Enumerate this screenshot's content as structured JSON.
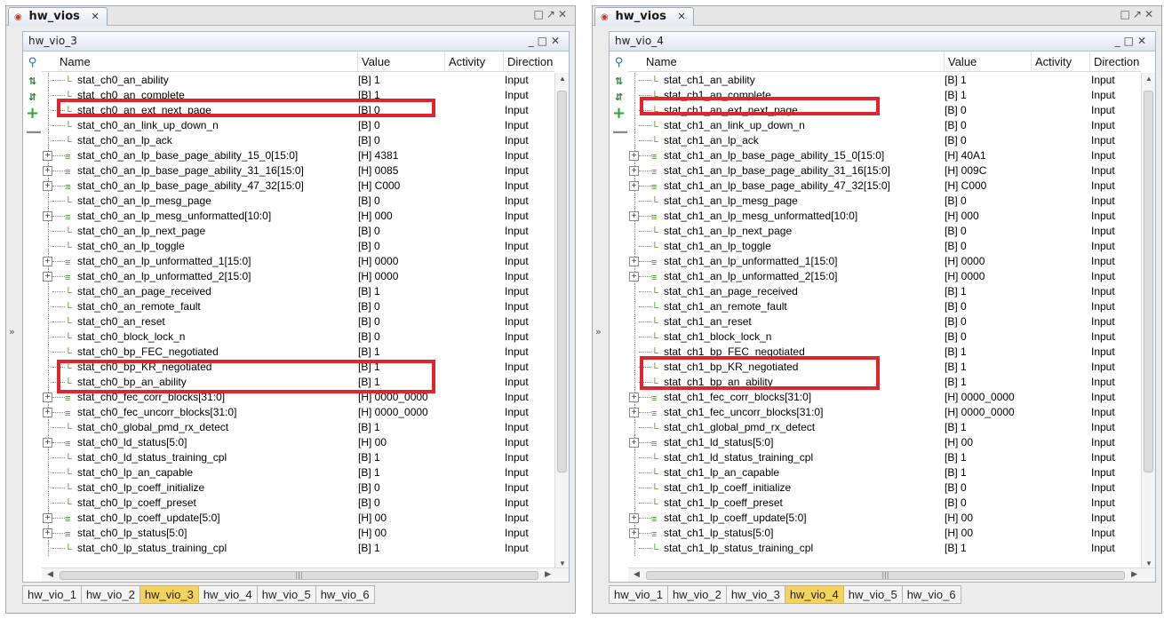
{
  "left": {
    "tab_title": "hw_vios",
    "panel_title": "hw_vio_3",
    "active_tab": "hw_vio_3",
    "rows": [
      {
        "name": "stat_ch0_an_ability",
        "value": "[B] 1",
        "dir": "Input",
        "bus": false
      },
      {
        "name": "stat_ch0_an_complete",
        "value": "[B] 1",
        "dir": "Input",
        "bus": false
      },
      {
        "name": "stat_ch0_an_ext_next_page",
        "value": "[B] 0",
        "dir": "Input",
        "bus": false
      },
      {
        "name": "stat_ch0_an_link_up_down_n",
        "value": "[B] 0",
        "dir": "Input",
        "bus": false
      },
      {
        "name": "stat_ch0_an_lp_ack",
        "value": "[B] 0",
        "dir": "Input",
        "bus": false
      },
      {
        "name": "stat_ch0_an_lp_base_page_ability_15_0[15:0]",
        "value": "[H] 4381",
        "dir": "Input",
        "bus": true
      },
      {
        "name": "stat_ch0_an_lp_base_page_ability_31_16[15:0]",
        "value": "[H] 0085",
        "dir": "Input",
        "bus": true
      },
      {
        "name": "stat_ch0_an_lp_base_page_ability_47_32[15:0]",
        "value": "[H] C000",
        "dir": "Input",
        "bus": true
      },
      {
        "name": "stat_ch0_an_lp_mesg_page",
        "value": "[B] 0",
        "dir": "Input",
        "bus": false
      },
      {
        "name": "stat_ch0_an_lp_mesg_unformatted[10:0]",
        "value": "[H] 000",
        "dir": "Input",
        "bus": true
      },
      {
        "name": "stat_ch0_an_lp_next_page",
        "value": "[B] 0",
        "dir": "Input",
        "bus": false
      },
      {
        "name": "stat_ch0_an_lp_toggle",
        "value": "[B] 0",
        "dir": "Input",
        "bus": false
      },
      {
        "name": "stat_ch0_an_lp_unformatted_1[15:0]",
        "value": "[H] 0000",
        "dir": "Input",
        "bus": true
      },
      {
        "name": "stat_ch0_an_lp_unformatted_2[15:0]",
        "value": "[H] 0000",
        "dir": "Input",
        "bus": true
      },
      {
        "name": "stat_ch0_an_page_received",
        "value": "[B] 1",
        "dir": "Input",
        "bus": false
      },
      {
        "name": "stat_ch0_an_remote_fault",
        "value": "[B] 0",
        "dir": "Input",
        "bus": false
      },
      {
        "name": "stat_ch0_an_reset",
        "value": "[B] 0",
        "dir": "Input",
        "bus": false
      },
      {
        "name": "stat_ch0_block_lock_n",
        "value": "[B] 0",
        "dir": "Input",
        "bus": false
      },
      {
        "name": "stat_ch0_bp_FEC_negotiated",
        "value": "[B] 1",
        "dir": "Input",
        "bus": false
      },
      {
        "name": "stat_ch0_bp_KR_negotiated",
        "value": "[B] 1",
        "dir": "Input",
        "bus": false
      },
      {
        "name": "stat_ch0_bp_an_ability",
        "value": "[B] 1",
        "dir": "Input",
        "bus": false
      },
      {
        "name": "stat_ch0_fec_corr_blocks[31:0]",
        "value": "[H] 0000_0000",
        "dir": "Input",
        "bus": true
      },
      {
        "name": "stat_ch0_fec_uncorr_blocks[31:0]",
        "value": "[H] 0000_0000",
        "dir": "Input",
        "bus": true
      },
      {
        "name": "stat_ch0_global_pmd_rx_detect",
        "value": "[B] 1",
        "dir": "Input",
        "bus": false
      },
      {
        "name": "stat_ch0_ld_status[5:0]",
        "value": "[H] 00",
        "dir": "Input",
        "bus": true
      },
      {
        "name": "stat_ch0_ld_status_training_cpl",
        "value": "[B] 1",
        "dir": "Input",
        "bus": false
      },
      {
        "name": "stat_ch0_lp_an_capable",
        "value": "[B] 1",
        "dir": "Input",
        "bus": false
      },
      {
        "name": "stat_ch0_lp_coeff_initialize",
        "value": "[B] 0",
        "dir": "Input",
        "bus": false
      },
      {
        "name": "stat_ch0_lp_coeff_preset",
        "value": "[B] 0",
        "dir": "Input",
        "bus": false
      },
      {
        "name": "stat_ch0_lp_coeff_update[5:0]",
        "value": "[H] 00",
        "dir": "Input",
        "bus": true
      },
      {
        "name": "stat_ch0_lp_status[5:0]",
        "value": "[H] 00",
        "dir": "Input",
        "bus": true
      },
      {
        "name": "stat_ch0_lp_status_training_cpl",
        "value": "[B] 1",
        "dir": "Input",
        "bus": false
      }
    ]
  },
  "right": {
    "tab_title": "hw_vios",
    "panel_title": "hw_vio_4",
    "active_tab": "hw_vio_4",
    "rows": [
      {
        "name": "stat_ch1_an_ability",
        "value": "[B] 1",
        "dir": "Input",
        "bus": false
      },
      {
        "name": "stat_ch1_an_complete",
        "value": "[B] 1",
        "dir": "Input",
        "bus": false
      },
      {
        "name": "stat_ch1_an_ext_next_page",
        "value": "[B] 0",
        "dir": "Input",
        "bus": false
      },
      {
        "name": "stat_ch1_an_link_up_down_n",
        "value": "[B] 0",
        "dir": "Input",
        "bus": false
      },
      {
        "name": "stat_ch1_an_lp_ack",
        "value": "[B] 0",
        "dir": "Input",
        "bus": false
      },
      {
        "name": "stat_ch1_an_lp_base_page_ability_15_0[15:0]",
        "value": "[H] 40A1",
        "dir": "Input",
        "bus": true
      },
      {
        "name": "stat_ch1_an_lp_base_page_ability_31_16[15:0]",
        "value": "[H] 009C",
        "dir": "Input",
        "bus": true
      },
      {
        "name": "stat_ch1_an_lp_base_page_ability_47_32[15:0]",
        "value": "[H] C000",
        "dir": "Input",
        "bus": true
      },
      {
        "name": "stat_ch1_an_lp_mesg_page",
        "value": "[B] 0",
        "dir": "Input",
        "bus": false
      },
      {
        "name": "stat_ch1_an_lp_mesg_unformatted[10:0]",
        "value": "[H] 000",
        "dir": "Input",
        "bus": true
      },
      {
        "name": "stat_ch1_an_lp_next_page",
        "value": "[B] 0",
        "dir": "Input",
        "bus": false
      },
      {
        "name": "stat_ch1_an_lp_toggle",
        "value": "[B] 0",
        "dir": "Input",
        "bus": false
      },
      {
        "name": "stat_ch1_an_lp_unformatted_1[15:0]",
        "value": "[H] 0000",
        "dir": "Input",
        "bus": true
      },
      {
        "name": "stat_ch1_an_lp_unformatted_2[15:0]",
        "value": "[H] 0000",
        "dir": "Input",
        "bus": true
      },
      {
        "name": "stat_ch1_an_page_received",
        "value": "[B] 1",
        "dir": "Input",
        "bus": false
      },
      {
        "name": "stat_ch1_an_remote_fault",
        "value": "[B] 0",
        "dir": "Input",
        "bus": false
      },
      {
        "name": "stat_ch1_an_reset",
        "value": "[B] 0",
        "dir": "Input",
        "bus": false
      },
      {
        "name": "stat_ch1_block_lock_n",
        "value": "[B] 0",
        "dir": "Input",
        "bus": false
      },
      {
        "name": "stat_ch1_bp_FEC_negotiated",
        "value": "[B] 1",
        "dir": "Input",
        "bus": false
      },
      {
        "name": "stat_ch1_bp_KR_negotiated",
        "value": "[B] 1",
        "dir": "Input",
        "bus": false
      },
      {
        "name": "stat_ch1_bp_an_ability",
        "value": "[B] 1",
        "dir": "Input",
        "bus": false
      },
      {
        "name": "stat_ch1_fec_corr_blocks[31:0]",
        "value": "[H] 0000_0000",
        "dir": "Input",
        "bus": true
      },
      {
        "name": "stat_ch1_fec_uncorr_blocks[31:0]",
        "value": "[H] 0000_0000",
        "dir": "Input",
        "bus": true
      },
      {
        "name": "stat_ch1_global_pmd_rx_detect",
        "value": "[B] 1",
        "dir": "Input",
        "bus": false
      },
      {
        "name": "stat_ch1_ld_status[5:0]",
        "value": "[H] 00",
        "dir": "Input",
        "bus": true
      },
      {
        "name": "stat_ch1_ld_status_training_cpl",
        "value": "[B] 1",
        "dir": "Input",
        "bus": false
      },
      {
        "name": "stat_ch1_lp_an_capable",
        "value": "[B] 1",
        "dir": "Input",
        "bus": false
      },
      {
        "name": "stat_ch1_lp_coeff_initialize",
        "value": "[B] 0",
        "dir": "Input",
        "bus": false
      },
      {
        "name": "stat_ch1_lp_coeff_preset",
        "value": "[B] 0",
        "dir": "Input",
        "bus": false
      },
      {
        "name": "stat_ch1_lp_coeff_update[5:0]",
        "value": "[H] 00",
        "dir": "Input",
        "bus": true
      },
      {
        "name": "stat_ch1_lp_status[5:0]",
        "value": "[H] 00",
        "dir": "Input",
        "bus": true
      },
      {
        "name": "stat_ch1_lp_status_training_cpl",
        "value": "[B] 1",
        "dir": "Input",
        "bus": false
      }
    ]
  },
  "columns": {
    "name": "Name",
    "value": "Value",
    "activity": "Activity",
    "direction": "Direction"
  },
  "bottom_tabs": [
    "hw_vio_1",
    "hw_vio_2",
    "hw_vio_3",
    "hw_vio_4",
    "hw_vio_5",
    "hw_vio_6"
  ],
  "icons": {
    "tab": "vio-probe-icon",
    "toolbar": [
      "search-icon",
      "collapse-all-icon",
      "expand-all-icon",
      "add-icon",
      "remove-icon"
    ],
    "row_signal": "probe-signal-icon",
    "row_bus": "probe-bus-icon",
    "window_controls": [
      "restore-icon",
      "float-icon",
      "close-icon"
    ]
  },
  "colors": {
    "highlight": "#e0252d",
    "active_tab": "#f3d35e"
  }
}
